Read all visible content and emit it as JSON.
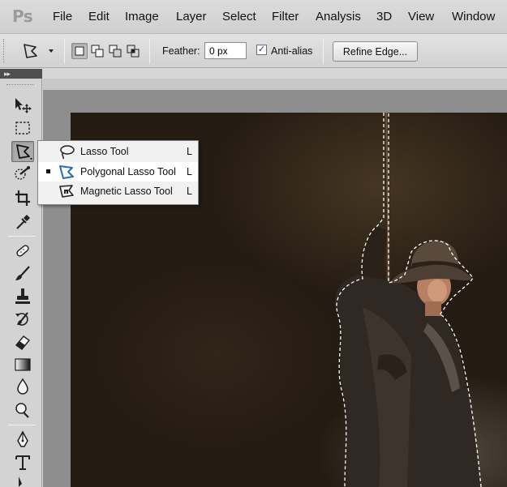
{
  "app": {
    "logo": "Ps"
  },
  "menu": {
    "items": [
      "File",
      "Edit",
      "Image",
      "Layer",
      "Select",
      "Filter",
      "Analysis",
      "3D",
      "View",
      "Window"
    ]
  },
  "options": {
    "feather_label": "Feather:",
    "feather_value": "0 px",
    "antialias_label": "Anti-alias",
    "antialias_checked": true,
    "refine_edge_label": "Refine Edge...",
    "selection_modes": [
      "new-selection",
      "add-to-selection",
      "subtract-from-selection",
      "intersect-with-selection"
    ],
    "active_selection_mode": "new-selection"
  },
  "toolbox": {
    "collapse_glyph": "▸▸",
    "tools": [
      {
        "name": "move-tool-icon"
      },
      {
        "name": "rectangular-marquee-icon"
      },
      {
        "name": "lasso-tool-icon",
        "active": true
      },
      {
        "name": "quick-selection-icon"
      },
      {
        "name": "crop-tool-icon"
      },
      {
        "name": "eyedropper-icon"
      },
      {
        "name": "spot-healing-brush-icon"
      },
      {
        "name": "brush-tool-icon"
      },
      {
        "name": "clone-stamp-icon"
      },
      {
        "name": "history-brush-icon"
      },
      {
        "name": "eraser-icon"
      },
      {
        "name": "gradient-tool-icon"
      },
      {
        "name": "blur-tool-icon"
      },
      {
        "name": "dodge-tool-icon"
      },
      {
        "name": "pen-tool-icon"
      },
      {
        "name": "type-tool-icon"
      },
      {
        "name": "path-selection-icon"
      }
    ]
  },
  "flyout": {
    "items": [
      {
        "label": "Lasso Tool",
        "shortcut": "L",
        "icon": "lasso-icon",
        "selected": false
      },
      {
        "label": "Polygonal Lasso Tool",
        "shortcut": "L",
        "icon": "polygonal-lasso-icon",
        "selected": true
      },
      {
        "label": "Magnetic Lasso Tool",
        "shortcut": "L",
        "icon": "magnetic-lasso-icon",
        "selected": false
      }
    ]
  },
  "colors": {
    "accent": "#2a6db0",
    "canvas_background": "#241b13"
  }
}
